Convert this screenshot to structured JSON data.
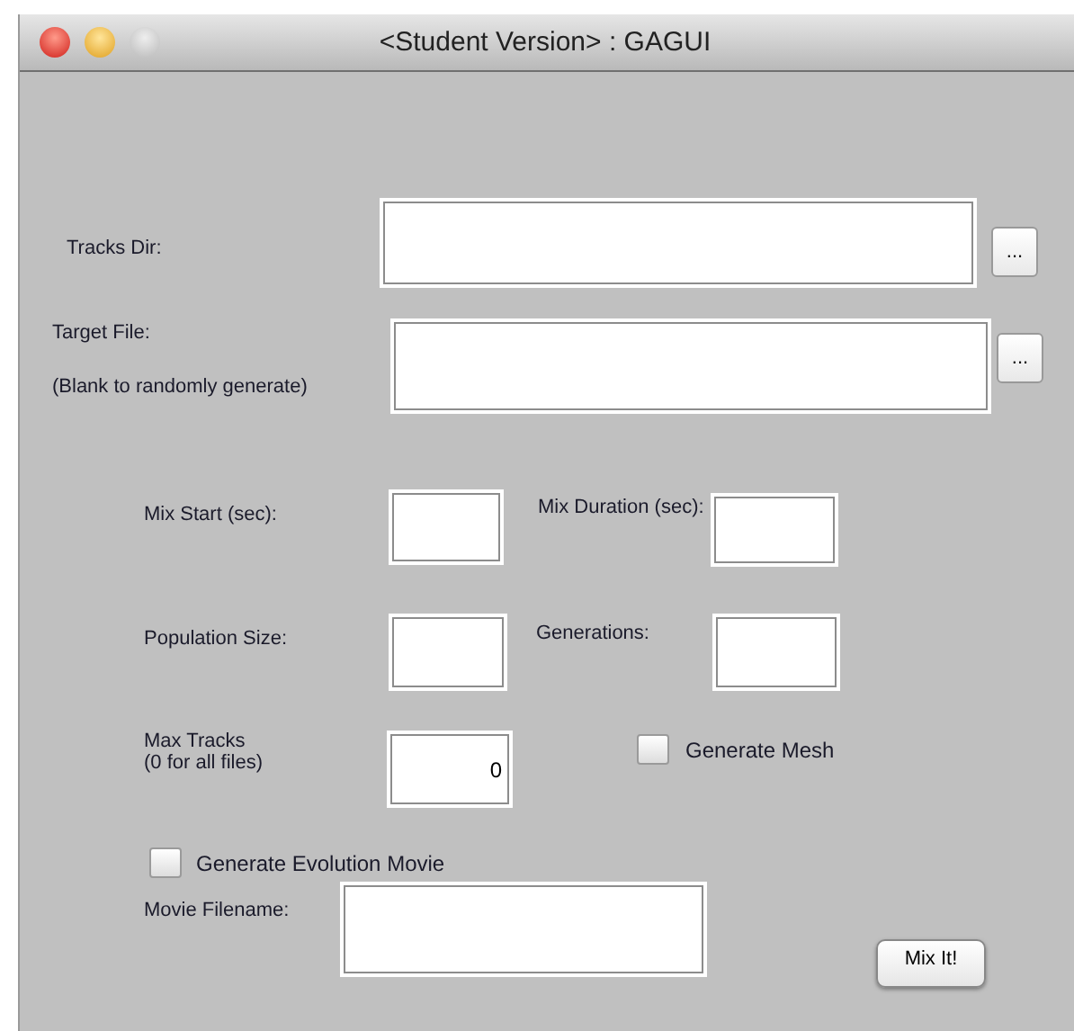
{
  "window": {
    "title": "<Student Version> : GAGUI"
  },
  "tracks_dir": {
    "label": "Tracks Dir:",
    "browse": "..."
  },
  "target_file": {
    "label": "Target File:",
    "hint": "(Blank to randomly generate)",
    "browse": "..."
  },
  "mix_start": {
    "label": "Mix Start (sec):"
  },
  "mix_duration": {
    "label": "Mix Duration (sec):"
  },
  "population_size": {
    "label": "Population Size:"
  },
  "generations": {
    "label": "Generations:"
  },
  "max_tracks": {
    "label": "Max Tracks",
    "hint": "(0 for all files)",
    "value": "0"
  },
  "generate_mesh": {
    "label": "Generate Mesh",
    "checked": false
  },
  "generate_movie": {
    "label": "Generate Evolution Movie",
    "checked": false
  },
  "movie_filename": {
    "label": "Movie Filename:"
  },
  "mix_button": "Mix It!"
}
